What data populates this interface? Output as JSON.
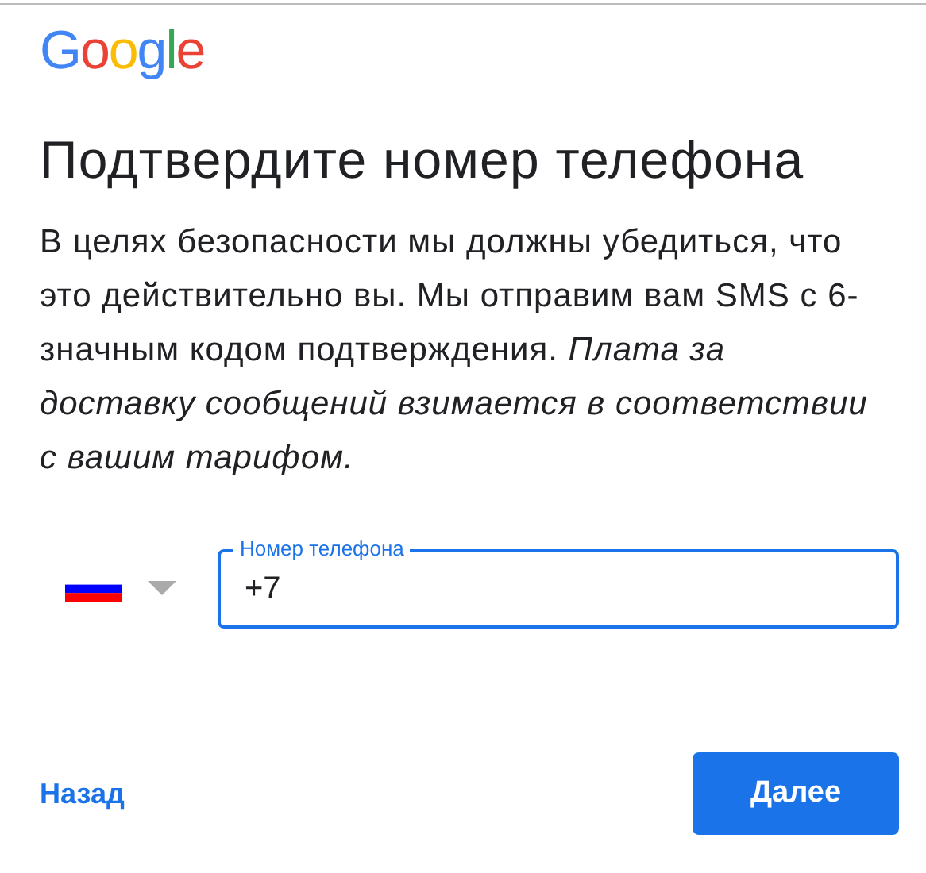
{
  "logo": "Google",
  "title": "Подтвердите номер телефона",
  "description": "В целях безопасности мы должны убедиться, что это действительно вы. Мы отправим вам SMS с 6-значным кодом подтверждения. *Плата за доставку сообщений взимается в соответствии с вашим тарифом.*",
  "phone_field": {
    "label": "Номер телефона",
    "value": "+7",
    "focused": true
  },
  "back_link": "Назад",
  "next_button": "Далее"
}
